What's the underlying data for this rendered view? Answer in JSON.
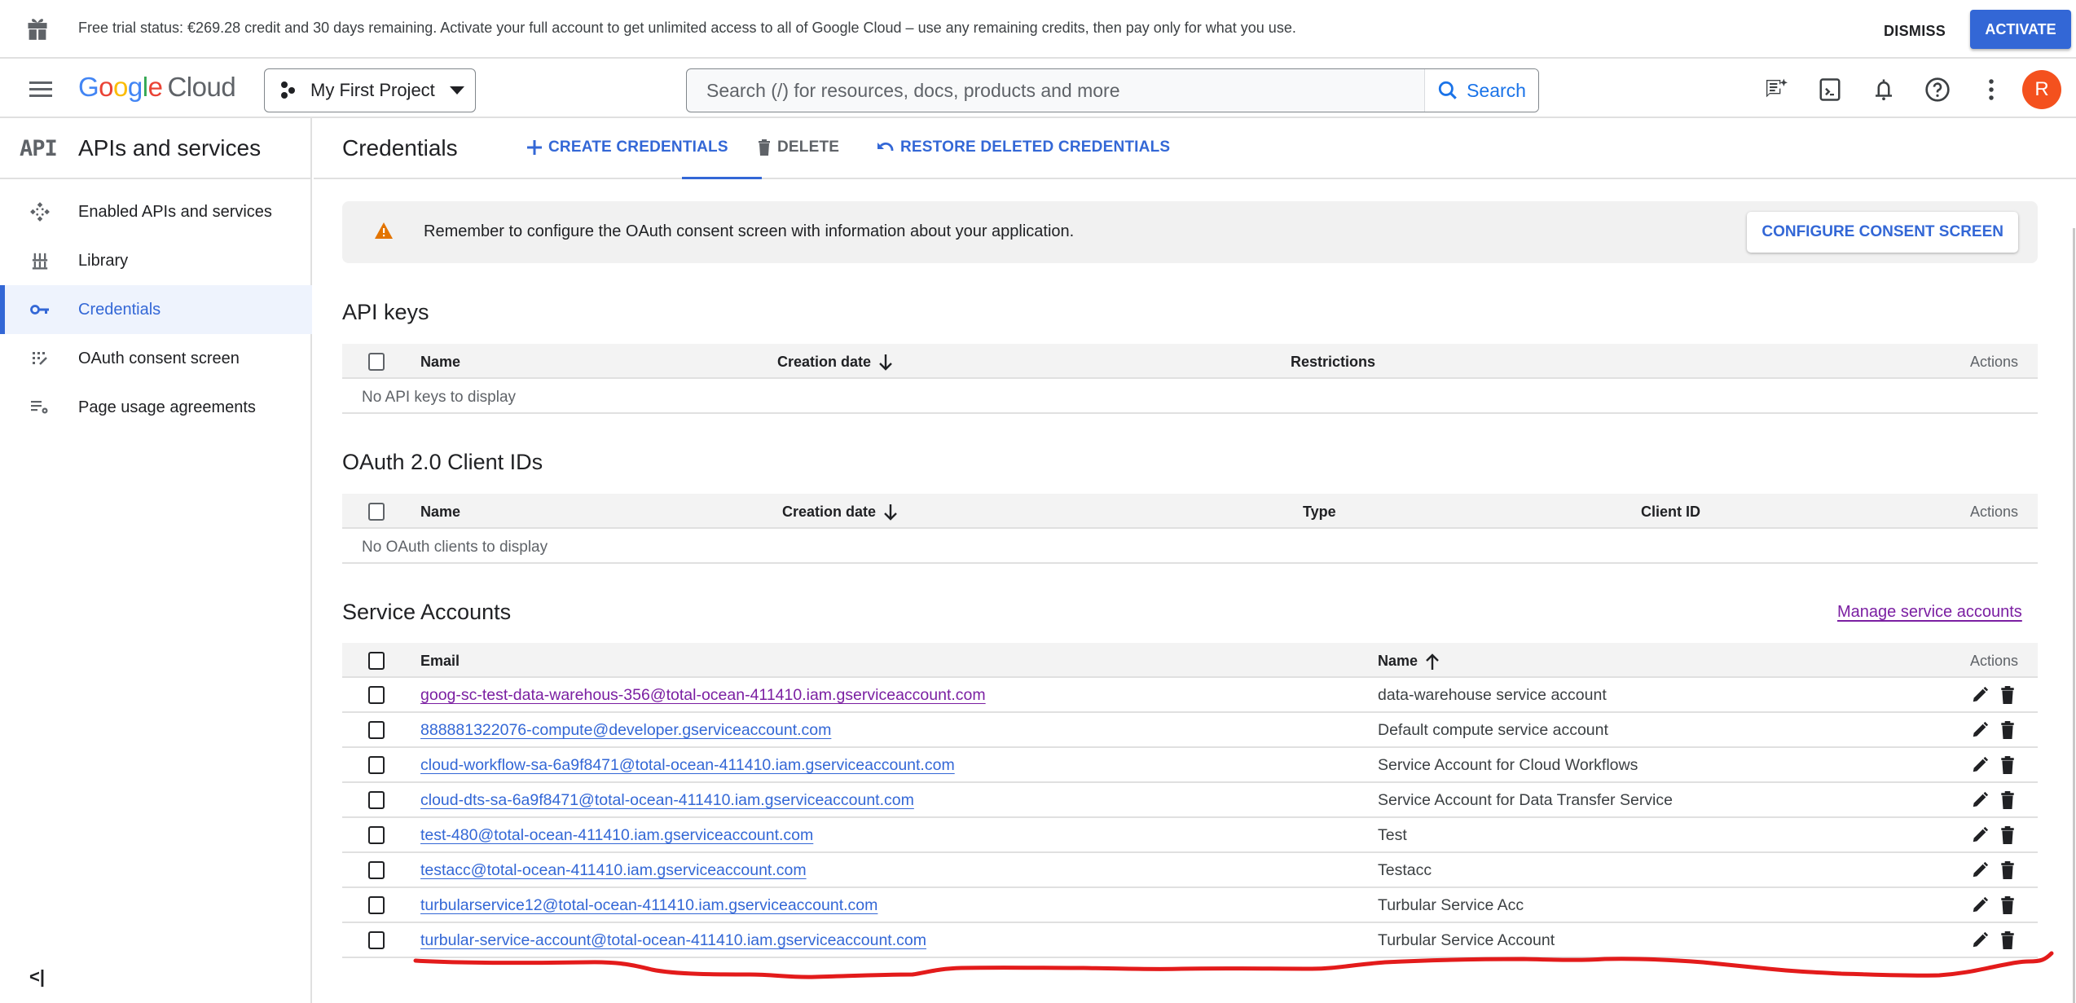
{
  "trial_banner": {
    "icon": "gift-icon",
    "message": "Free trial status: €269.28 credit and 30 days remaining. Activate your full account to get unlimited access to all of Google Cloud – use any remaining credits, then pay only for what you use.",
    "dismiss_label": "DISMISS",
    "activate_label": "ACTIVATE"
  },
  "header": {
    "menu_icon": "hamburger-menu-icon",
    "logo": {
      "google": [
        "G",
        "o",
        "o",
        "g",
        "l",
        "e"
      ],
      "product": "Cloud"
    },
    "project_selector": {
      "label": "My First Project",
      "icon": "project-icon",
      "caret": "dropdown-caret-icon"
    },
    "search": {
      "placeholder": "Search (/) for resources, docs, products and more",
      "value": "",
      "button_label": "Search"
    },
    "icons": [
      "gemini-chat-icon",
      "cloud-shell-icon",
      "notifications-icon",
      "help-icon",
      "more-vert-icon"
    ],
    "avatar_initial": "R",
    "colors": {
      "avatar": "#f4511e",
      "brand_blue": "#3367d6"
    }
  },
  "sidebar": {
    "product_glyph": "API",
    "product_title": "APIs and services",
    "items": [
      {
        "label": "Enabled APIs and services",
        "icon": "enabled-apis-icon",
        "active": false
      },
      {
        "label": "Library",
        "icon": "library-icon",
        "active": false
      },
      {
        "label": "Credentials",
        "icon": "key-icon",
        "active": true
      },
      {
        "label": "OAuth consent screen",
        "icon": "oauth-consent-icon",
        "active": false
      },
      {
        "label": "Page usage agreements",
        "icon": "page-settings-icon",
        "active": false
      }
    ],
    "collapse_label": "<|"
  },
  "toolbar": {
    "title": "Credentials",
    "create_label": "CREATE CREDENTIALS",
    "delete_label": "DELETE",
    "restore_label": "RESTORE DELETED CREDENTIALS"
  },
  "alert": {
    "message": "Remember to configure the OAuth consent screen with information about your application.",
    "button_label": "CONFIGURE CONSENT SCREEN"
  },
  "api_keys": {
    "title": "API keys",
    "columns": [
      "Name",
      "Creation date",
      "Restrictions",
      "Actions"
    ],
    "sort": {
      "column": "Creation date",
      "direction": "descending"
    },
    "empty_text": "No API keys to display"
  },
  "oauth_clients": {
    "title": "OAuth 2.0 Client IDs",
    "columns": [
      "Name",
      "Creation date",
      "Type",
      "Client ID",
      "Actions"
    ],
    "sort": {
      "column": "Creation date",
      "direction": "descending"
    },
    "empty_text": "No OAuth clients to display"
  },
  "service_accounts": {
    "title": "Service Accounts",
    "manage_link": "Manage service accounts",
    "columns": [
      "Email",
      "Name",
      "Actions"
    ],
    "sort": {
      "column": "Name",
      "direction": "ascending"
    },
    "rows": [
      {
        "email": "goog-sc-test-data-warehous-356@total-ocean-411410.iam.gserviceaccount.com",
        "name": "data-warehouse service account",
        "visited": true
      },
      {
        "email": "888881322076-compute@developer.gserviceaccount.com",
        "name": "Default compute service account",
        "visited": false
      },
      {
        "email": "cloud-workflow-sa-6a9f8471@total-ocean-411410.iam.gserviceaccount.com",
        "name": "Service Account for Cloud Workflows",
        "visited": false
      },
      {
        "email": "cloud-dts-sa-6a9f8471@total-ocean-411410.iam.gserviceaccount.com",
        "name": "Service Account for Data Transfer Service",
        "visited": false
      },
      {
        "email": "test-480@total-ocean-411410.iam.gserviceaccount.com",
        "name": "Test",
        "visited": false
      },
      {
        "email": "testacc@total-ocean-411410.iam.gserviceaccount.com",
        "name": "Testacc",
        "visited": false
      },
      {
        "email": "turbularservice12@total-ocean-411410.iam.gserviceaccount.com",
        "name": "Turbular Service Acc",
        "visited": false
      },
      {
        "email": "turbular-service-account@total-ocean-411410.iam.gserviceaccount.com",
        "name": "Turbular Service Account",
        "visited": false
      }
    ],
    "row_actions": [
      "edit-icon",
      "delete-icon"
    ]
  },
  "annotation": {
    "type": "freehand-underline",
    "color": "#e31b1b",
    "target": "turbular-service-account row"
  }
}
